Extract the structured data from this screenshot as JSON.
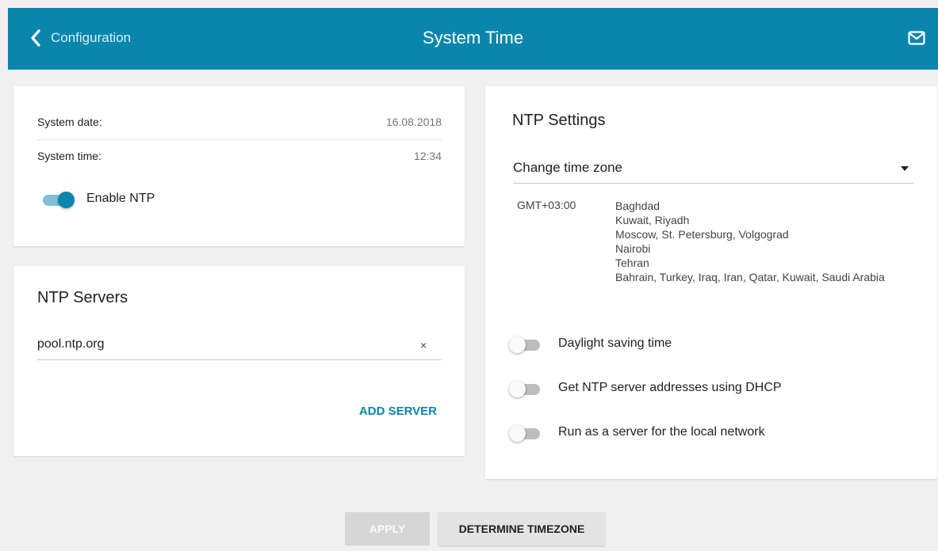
{
  "header": {
    "back_label": "Configuration",
    "title": "System Time",
    "accent": "#0a86ad"
  },
  "status": {
    "date_label": "System date:",
    "date_value": "16.08.2018",
    "time_label": "System time:",
    "time_value": "12:34",
    "ntp_label": "Enable NTP",
    "ntp_enabled": true
  },
  "servers": {
    "title": "NTP Servers",
    "items": [
      "pool.ntp.org"
    ],
    "clear_glyph": "×",
    "add_label": "ADD SERVER"
  },
  "ntp_settings": {
    "title": "NTP Settings",
    "timezone_select": "Change time zone",
    "gmt": "GMT+03:00",
    "cities": [
      "Baghdad",
      "Kuwait, Riyadh",
      "Moscow, St. Petersburg, Volgograd",
      "Nairobi",
      "Tehran",
      "Bahrain, Turkey, Iraq, Iran, Qatar, Kuwait, Saudi Arabia"
    ],
    "toggles": [
      {
        "label": "Daylight saving time",
        "enabled": false
      },
      {
        "label": "Get NTP server addresses using DHCP",
        "enabled": false
      },
      {
        "label": "Run as a server for the local network",
        "enabled": false
      }
    ]
  },
  "actions": {
    "apply_label": "APPLY",
    "determine_label": "DETERMINE TIMEZONE"
  },
  "icons": {
    "back": "chevron-left-icon",
    "mail": "mail-icon",
    "dropdown": "caret-down-icon"
  }
}
